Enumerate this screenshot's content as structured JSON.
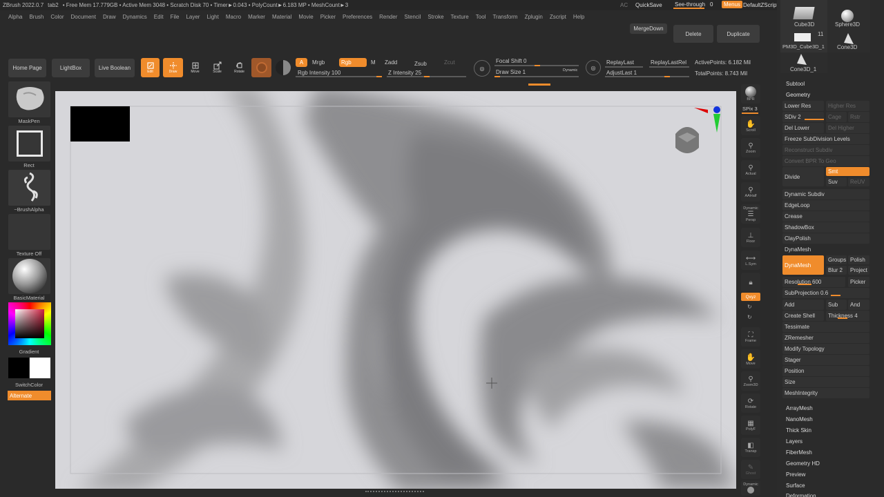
{
  "titlebar": {
    "app": "ZBrush 2022.0.7",
    "doc": "tab2",
    "stats": "• Free Mem 17.779GB • Active Mem 3048 • Scratch Disk 70 • Timer►0.043 • PolyCount►6.183 MP • MeshCount►3",
    "ac": "AC",
    "quicksave": "QuickSave",
    "seethrough": "See-through",
    "seethrough_value": "0",
    "menus": "Menus",
    "script": "DefaultZScript"
  },
  "menus": [
    "Alpha",
    "Brush",
    "Color",
    "Document",
    "Draw",
    "Dynamics",
    "Edit",
    "File",
    "Layer",
    "Light",
    "Macro",
    "Marker",
    "Material",
    "Movie",
    "Picker",
    "Preferences",
    "Render",
    "Stencil",
    "Stroke",
    "Texture",
    "Tool",
    "Transform",
    "Zplugin",
    "Zscript",
    "Help"
  ],
  "toolbar": {
    "mergedown": "MergeDown",
    "delete": "Delete",
    "duplicate": "Duplicate",
    "homepage": "Home Page",
    "lightbox": "LightBox",
    "liveboolean": "Live Boolean",
    "edit": "Edit",
    "draw": "Draw",
    "move": "Move",
    "scale": "Scale",
    "rotate": "Rotate",
    "a": "A",
    "mrgb": "Mrgb",
    "rgb": "Rgb",
    "m": "M",
    "zadd": "Zadd",
    "zsub": "Zsub",
    "zcut": "Zcut",
    "rgb_intensity": "Rgb Intensity 100",
    "z_intensity": "Z Intensity 25",
    "focal_shift": "Focal Shift 0",
    "draw_size": "Draw Size 1",
    "dynamic": "Dynamic",
    "replaylast": "ReplayLast",
    "replaylastrel": "ReplayLastRel",
    "adjustlast": "AdjustLast 1",
    "activepoints": "ActivePoints: 6.182 Mil",
    "totalpoints": "TotalPoints: 8.743 Mil"
  },
  "leftshelf": {
    "brush": "MaskPen",
    "stroke": "Rect",
    "alpha": "~BrushAlpha",
    "texture": "Texture Off",
    "material": "BasicMaterial",
    "gradient": "Gradient",
    "switchcolor": "SwitchColor",
    "alternate": "Alternate"
  },
  "rightshelf": {
    "bpr": "BPR",
    "spix": "SPix 3",
    "scroll": "Scroll",
    "zoom": "Zoom",
    "actual": "Actual",
    "aahalf": "AAHalf",
    "persp": "Persp",
    "floor": "Floor",
    "lsym": "L.Sym",
    "xyz": "Qxyz",
    "frame": "Frame",
    "move": "Move",
    "zoom3d": "Zoom3D",
    "rotate": "Rotate",
    "polyf": "PolyF",
    "transp": "Transp",
    "ghost": "Ghost",
    "solo": "Dynamic"
  },
  "toolthumbs": {
    "cube": "Cube3D",
    "sphere": "Sphere3D",
    "pm3d": "PM3D_Cube3D_1",
    "pm3d_count": "11",
    "cone": "Cone3D",
    "cone1": "Cone3D_1"
  },
  "subtool": {
    "subtool": "Subtool",
    "geometry": "Geometry",
    "lower_res": "Lower Res",
    "higher_res": "Higher Res",
    "sdiv": "SDiv 2",
    "cage": "Cage",
    "rstr": "Rstr",
    "del_lower": "Del Lower",
    "del_higher": "Del Higher",
    "freeze": "Freeze SubDivision Levels",
    "reconstruct": "Reconstruct Subdiv",
    "convert": "Convert BPR To Geo",
    "divide": "Divide",
    "smt": "Smt",
    "suv": "Suv",
    "reuv": "ReUV",
    "dynamic_subdiv": "Dynamic Subdiv",
    "edgeloop": "EdgeLoop",
    "crease": "Crease",
    "shadowbox": "ShadowBox",
    "claypolish": "ClayPolish",
    "dynamesh_head": "DynaMesh",
    "dynamesh_btn": "DynaMesh",
    "groups": "Groups",
    "polish": "Polish",
    "blur": "Blur 2",
    "project": "Project",
    "resolution": "Resolution 600",
    "picker": "Picker",
    "subprojection": "SubProjection 0.6",
    "add": "Add",
    "sub": "Sub",
    "and": "And",
    "create_shell": "Create Shell",
    "thickness": "Thickness 4",
    "tessimate": "Tessimate",
    "zremesher": "ZRemesher",
    "modify_topology": "Modify Topology",
    "stager": "Stager",
    "position": "Position",
    "size": "Size",
    "meshintegrity": "MeshIntegrity",
    "arraymesh": "ArrayMesh",
    "nanomesh": "NanoMesh",
    "thickskin": "Thick Skin",
    "layers": "Layers",
    "fibermesh": "FiberMesh",
    "geometryhd": "Geometry HD",
    "preview": "Preview",
    "surface": "Surface",
    "deformation": "Deformation"
  },
  "colors": {
    "accent": "#f08c2c",
    "panel": "#2a2a2a",
    "canvas": "#d4d4d8"
  }
}
